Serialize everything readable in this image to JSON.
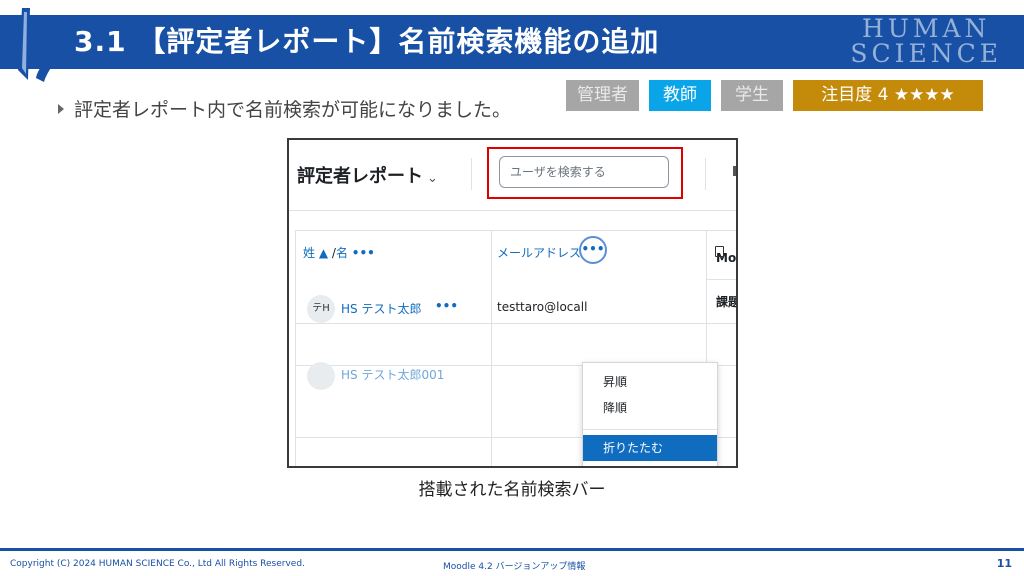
{
  "slide": {
    "title": "3.1 【評定者レポート】名前検索機能の追加",
    "brand_line1": "HUMAN",
    "brand_line2": "SCIENCE",
    "bullet": "評定者レポート内で名前検索が可能になりました。",
    "caption": "搭載された名前検索バー"
  },
  "badges": {
    "admin": "管理者",
    "teacher": "教師",
    "student": "学生",
    "attention": "注目度 4 ★★★★",
    "colors": {
      "active": "#0aa5e8",
      "inactive": "#a6a6a6",
      "attention": "#c48a0a"
    }
  },
  "screenshot": {
    "report_title": "評定者レポート",
    "report_caret": "⌄",
    "search_placeholder": "ユーザを検索する",
    "col_head_1": "Mo",
    "col_head_2": "課題",
    "sort_name_first": "姓",
    "sort_arrow": "▲",
    "sort_sep": "/",
    "sort_name_last": "名",
    "more": "•••",
    "email_header": "メールアドレス",
    "user_initials": "テH",
    "user_name": "HS テスト太郎",
    "user_email": "testtaro@locall",
    "user2_name": "HS テスト太郎001",
    "menu": {
      "asc": "昇順",
      "desc": "降順",
      "collapse": "折りたたむ"
    }
  },
  "footer": {
    "copyright": "Copyright (C) 2024 HUMAN SCIENCE Co., Ltd All Rights Reserved.",
    "doc": "Moodle 4.2 バージョンアップ情報",
    "page": "11"
  },
  "icons": [
    "logo-icon",
    "bullet-triangle-icon",
    "chevron-down-icon",
    "more-dots-icon",
    "file-icon"
  ]
}
